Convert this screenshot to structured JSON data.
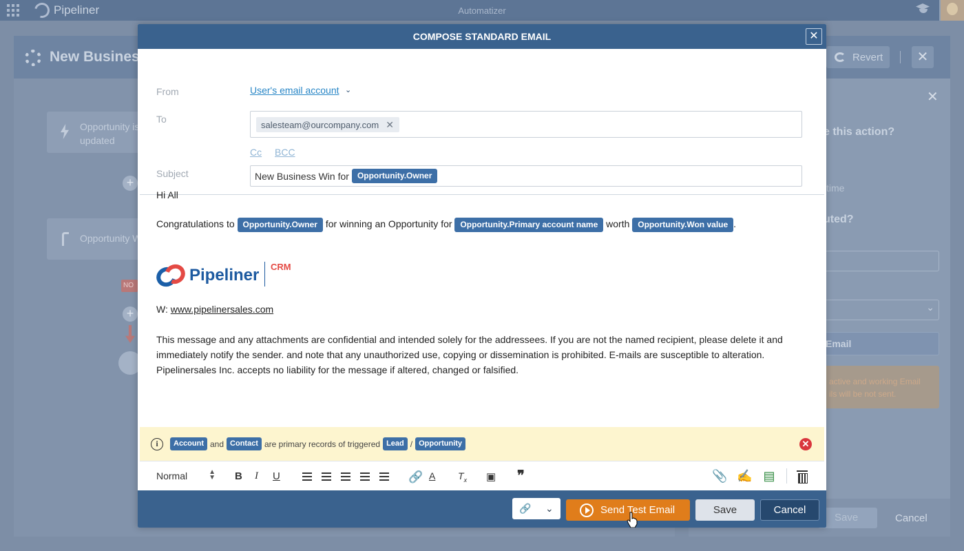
{
  "app": {
    "brand": "Pipeliner",
    "title": "Automatizer"
  },
  "background": {
    "page_title": "New Business",
    "revert_label": "Revert",
    "card_trigger": "Opportunity is updated",
    "card_trigger_line1": "Opportunity is",
    "card_trigger_line2": "updated",
    "card_condition": "Opportunity W",
    "no_tag": "NO",
    "right_q1": "e this action?",
    "right_time": "time",
    "right_q2": "uted?",
    "right_email_btn": "Email",
    "right_warning_line1": "active and working Email",
    "right_warning_line2": "ils will be not sent.",
    "save_label": "Save",
    "cancel_label": "Cancel"
  },
  "modal": {
    "title": "COMPOSE STANDARD EMAIL",
    "from_label": "From",
    "from_value": "User's email account",
    "to_label": "To",
    "to_recipients": [
      "salesteam@ourcompany.com"
    ],
    "cc_label": "Cc",
    "bcc_label": "BCC",
    "subject_label": "Subject",
    "subject_text": "New Business Win for",
    "subject_token": "Opportunity.Owner",
    "body": {
      "greeting": "Hi All",
      "congrats_text1": "Congratulations to",
      "congrats_token1": "Opportunity.Owner",
      "congrats_text2": "for winning an Opportunity for",
      "congrats_token2": "Opportunity.Primary account name",
      "congrats_text3": "worth",
      "congrats_token3": "Opportunity.Won value",
      "congrats_end": ".",
      "logo_text": "Pipeliner",
      "logo_crm": "CRM",
      "web_prefix": "W:",
      "web_url": "www.pipelinersales.com",
      "disclaimer_line1": "This message and any attachments are confidential and intended solely for the addressees. If you are not the named recipient, please delete it and",
      "disclaimer_line2": "immediately notify the sender. and note that any unauthorized use, copying or dissemination is prohibited. E-mails are susceptible to alteration.",
      "disclaimer_line3": "Pipelinersales Inc. accepts no liability for the message if altered, changed or falsified."
    },
    "info": {
      "token_account": "Account",
      "and_text": "and",
      "token_contact": "Contact",
      "middle_text": "are primary records of triggered",
      "token_lead": "Lead",
      "slash": "/",
      "token_opportunity": "Opportunity"
    },
    "toolbar": {
      "format_value": "Normal",
      "bold": "B",
      "italic": "I",
      "underline": "U",
      "quote": "❞"
    },
    "footer": {
      "send_test_label": "Send Test Email",
      "save_label": "Save",
      "cancel_label": "Cancel"
    }
  },
  "colors": {
    "modal_header": "#3a628e",
    "token": "#3d6fa7",
    "send_button": "#e07d1b",
    "info_bar": "#fdf5cf",
    "info_close": "#d9363e"
  },
  "icons": {
    "apps": "grid-icon",
    "close": "close-icon",
    "info": "info-icon",
    "attach": "paperclip-icon",
    "signature": "pen-icon",
    "template": "template-icon",
    "delete": "trash-icon",
    "link": "link-icon",
    "play": "play-circle-icon"
  }
}
